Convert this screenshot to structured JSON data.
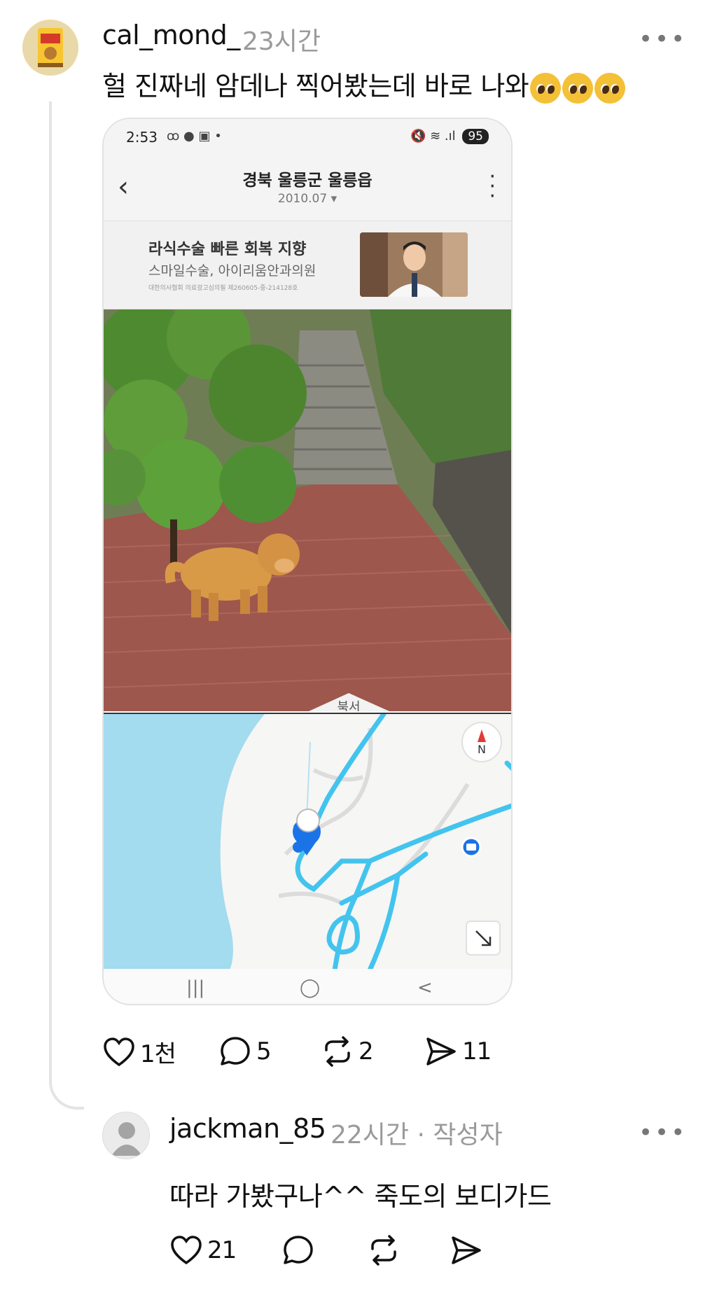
{
  "post": {
    "username": "cal_mond_",
    "time": "23시간",
    "text": "헐 진짜네 암데나 찍어봤는데 바로 나와",
    "more_label": "•••",
    "emoji_name": "pleading-face-emoji",
    "actions": {
      "likes": "1천",
      "comments": "5",
      "reposts": "2",
      "shares": "11"
    }
  },
  "screenshot": {
    "status_time": "2:53",
    "status_icons_left": "ꝏ ● ▣ •",
    "status_icons_right": "🔇 ≋ .ıl",
    "battery": "95",
    "title": "경북 울릉군 울릉읍",
    "date": "2010.07 ▾",
    "ad": {
      "headline": "라식수술 빠른 회복 지향",
      "sub": "스마일수술, 아이리움안과의원",
      "fineprint": "대한의사협회 의료광고심의필 제260605-중-214128호"
    },
    "compass_label": "N",
    "photo_overlay_label": "북서",
    "nav": {
      "recent": "|||",
      "home": "◯",
      "back": "<"
    }
  },
  "reply": {
    "username": "jackman_85",
    "time": "22시간 · 작성자",
    "text": "따라 가봤구나^^ 죽도의 보디가드",
    "more_label": "•••",
    "actions": {
      "likes": "21"
    }
  },
  "colors": {
    "accent_map_route": "#43c4ee",
    "water": "#9fd9ee",
    "pin": "#1b73e8",
    "muted_text": "#9a9a9a"
  }
}
